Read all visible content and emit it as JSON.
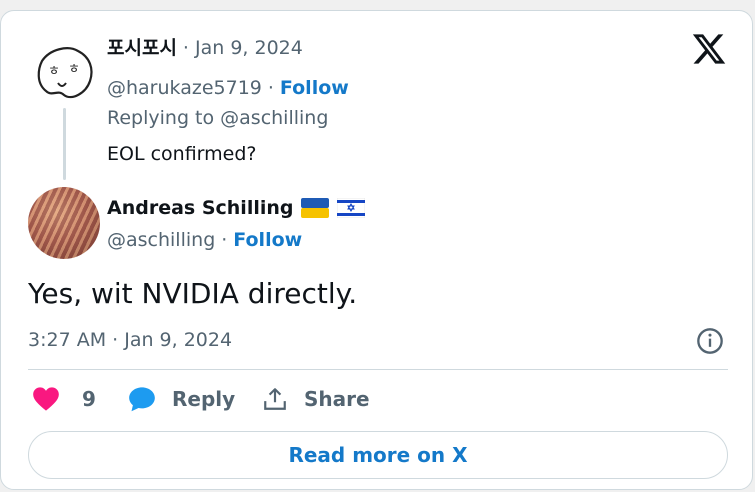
{
  "reply_to_tweet": {
    "display_name": "포시포시",
    "date": "· Jan 9, 2024",
    "handle": "@harukaze5719",
    "separator": "·",
    "follow_label": "Follow",
    "replying_to": "Replying to @aschilling",
    "text": "EOL confirmed?"
  },
  "main_tweet": {
    "display_name": "Andreas Schilling",
    "flags": [
      "ukraine-flag-icon",
      "israel-flag-icon"
    ],
    "handle": "@aschilling",
    "separator": "·",
    "follow_label": "Follow",
    "text": "Yes, wit NVIDIA directly.",
    "timestamp": "3:27 AM · Jan 9, 2024"
  },
  "actions": {
    "like_count": "9",
    "reply_label": "Reply",
    "share_label": "Share"
  },
  "read_more_label": "Read more on X",
  "colors": {
    "like": "#f91880",
    "reply": "#1d9bf0",
    "link": "#1479c9",
    "muted": "#536471",
    "border": "#cfd9de"
  }
}
